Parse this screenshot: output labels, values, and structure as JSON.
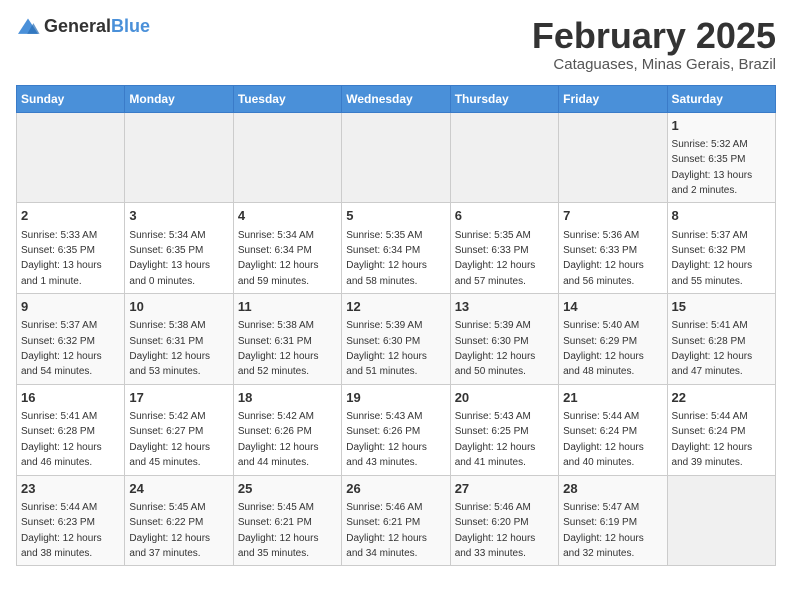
{
  "logo": {
    "text_general": "General",
    "text_blue": "Blue"
  },
  "title": "February 2025",
  "subtitle": "Cataguases, Minas Gerais, Brazil",
  "days_of_week": [
    "Sunday",
    "Monday",
    "Tuesday",
    "Wednesday",
    "Thursday",
    "Friday",
    "Saturday"
  ],
  "weeks": [
    [
      {
        "day": "",
        "info": ""
      },
      {
        "day": "",
        "info": ""
      },
      {
        "day": "",
        "info": ""
      },
      {
        "day": "",
        "info": ""
      },
      {
        "day": "",
        "info": ""
      },
      {
        "day": "",
        "info": ""
      },
      {
        "day": "1",
        "info": "Sunrise: 5:32 AM\nSunset: 6:35 PM\nDaylight: 13 hours and 2 minutes."
      }
    ],
    [
      {
        "day": "2",
        "info": "Sunrise: 5:33 AM\nSunset: 6:35 PM\nDaylight: 13 hours and 1 minute."
      },
      {
        "day": "3",
        "info": "Sunrise: 5:34 AM\nSunset: 6:35 PM\nDaylight: 13 hours and 0 minutes."
      },
      {
        "day": "4",
        "info": "Sunrise: 5:34 AM\nSunset: 6:34 PM\nDaylight: 12 hours and 59 minutes."
      },
      {
        "day": "5",
        "info": "Sunrise: 5:35 AM\nSunset: 6:34 PM\nDaylight: 12 hours and 58 minutes."
      },
      {
        "day": "6",
        "info": "Sunrise: 5:35 AM\nSunset: 6:33 PM\nDaylight: 12 hours and 57 minutes."
      },
      {
        "day": "7",
        "info": "Sunrise: 5:36 AM\nSunset: 6:33 PM\nDaylight: 12 hours and 56 minutes."
      },
      {
        "day": "8",
        "info": "Sunrise: 5:37 AM\nSunset: 6:32 PM\nDaylight: 12 hours and 55 minutes."
      }
    ],
    [
      {
        "day": "9",
        "info": "Sunrise: 5:37 AM\nSunset: 6:32 PM\nDaylight: 12 hours and 54 minutes."
      },
      {
        "day": "10",
        "info": "Sunrise: 5:38 AM\nSunset: 6:31 PM\nDaylight: 12 hours and 53 minutes."
      },
      {
        "day": "11",
        "info": "Sunrise: 5:38 AM\nSunset: 6:31 PM\nDaylight: 12 hours and 52 minutes."
      },
      {
        "day": "12",
        "info": "Sunrise: 5:39 AM\nSunset: 6:30 PM\nDaylight: 12 hours and 51 minutes."
      },
      {
        "day": "13",
        "info": "Sunrise: 5:39 AM\nSunset: 6:30 PM\nDaylight: 12 hours and 50 minutes."
      },
      {
        "day": "14",
        "info": "Sunrise: 5:40 AM\nSunset: 6:29 PM\nDaylight: 12 hours and 48 minutes."
      },
      {
        "day": "15",
        "info": "Sunrise: 5:41 AM\nSunset: 6:28 PM\nDaylight: 12 hours and 47 minutes."
      }
    ],
    [
      {
        "day": "16",
        "info": "Sunrise: 5:41 AM\nSunset: 6:28 PM\nDaylight: 12 hours and 46 minutes."
      },
      {
        "day": "17",
        "info": "Sunrise: 5:42 AM\nSunset: 6:27 PM\nDaylight: 12 hours and 45 minutes."
      },
      {
        "day": "18",
        "info": "Sunrise: 5:42 AM\nSunset: 6:26 PM\nDaylight: 12 hours and 44 minutes."
      },
      {
        "day": "19",
        "info": "Sunrise: 5:43 AM\nSunset: 6:26 PM\nDaylight: 12 hours and 43 minutes."
      },
      {
        "day": "20",
        "info": "Sunrise: 5:43 AM\nSunset: 6:25 PM\nDaylight: 12 hours and 41 minutes."
      },
      {
        "day": "21",
        "info": "Sunrise: 5:44 AM\nSunset: 6:24 PM\nDaylight: 12 hours and 40 minutes."
      },
      {
        "day": "22",
        "info": "Sunrise: 5:44 AM\nSunset: 6:24 PM\nDaylight: 12 hours and 39 minutes."
      }
    ],
    [
      {
        "day": "23",
        "info": "Sunrise: 5:44 AM\nSunset: 6:23 PM\nDaylight: 12 hours and 38 minutes."
      },
      {
        "day": "24",
        "info": "Sunrise: 5:45 AM\nSunset: 6:22 PM\nDaylight: 12 hours and 37 minutes."
      },
      {
        "day": "25",
        "info": "Sunrise: 5:45 AM\nSunset: 6:21 PM\nDaylight: 12 hours and 35 minutes."
      },
      {
        "day": "26",
        "info": "Sunrise: 5:46 AM\nSunset: 6:21 PM\nDaylight: 12 hours and 34 minutes."
      },
      {
        "day": "27",
        "info": "Sunrise: 5:46 AM\nSunset: 6:20 PM\nDaylight: 12 hours and 33 minutes."
      },
      {
        "day": "28",
        "info": "Sunrise: 5:47 AM\nSunset: 6:19 PM\nDaylight: 12 hours and 32 minutes."
      },
      {
        "day": "",
        "info": ""
      }
    ]
  ]
}
